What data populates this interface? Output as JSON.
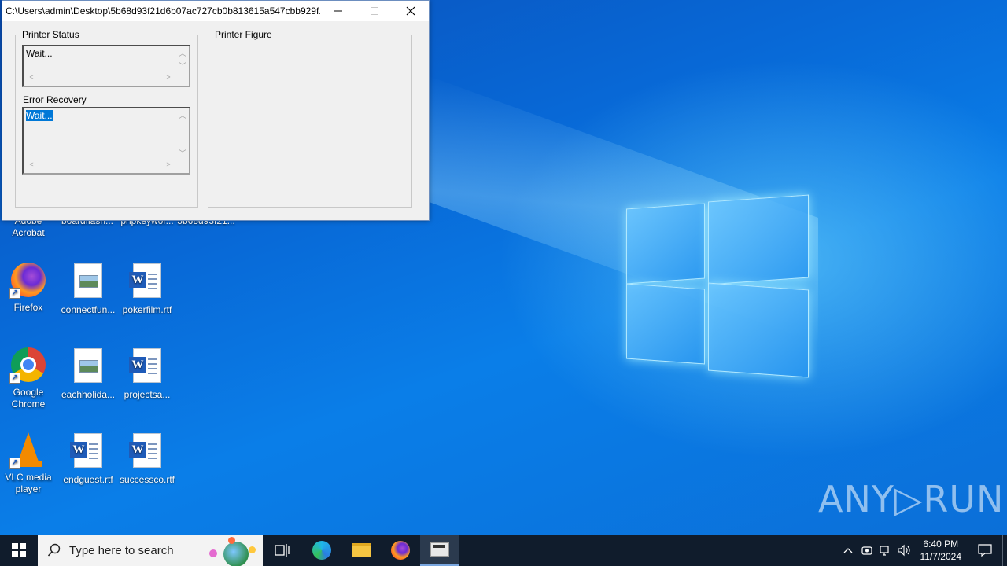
{
  "window": {
    "title": "C:\\Users\\admin\\Desktop\\5b68d93f21d6b07ac727cb0b813615a547cbb929f...",
    "printer_status_group": "Printer Status",
    "printer_status_text": "Wait...",
    "error_recovery_label": "Error Recovery",
    "error_recovery_text": "Wait...",
    "printer_figure_group": "Printer Figure"
  },
  "desktop_icons": {
    "row_top": [
      "Adobe Acrobat",
      "boardflash...",
      "phpkeywor...",
      "5b68d93f21..."
    ],
    "firefox": "Firefox",
    "connectfun": "connectfun...",
    "pokerfilm": "pokerfilm.rtf",
    "chrome": "Google Chrome",
    "eachholida": "eachholida...",
    "projectsa": "projectsa...",
    "vlc": "VLC media player",
    "endguest": "endguest.rtf",
    "successco": "successco.rtf"
  },
  "taskbar": {
    "search_placeholder": "Type here to search",
    "time": "6:40 PM",
    "date": "11/7/2024"
  },
  "watermark": "ANY▷RUN"
}
